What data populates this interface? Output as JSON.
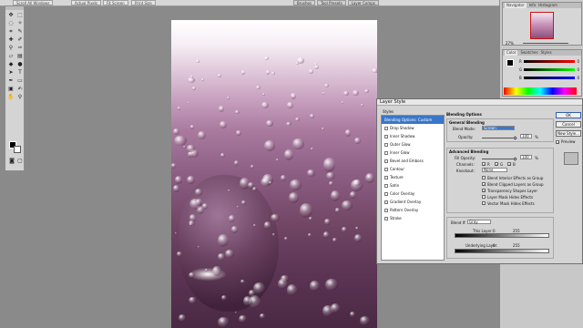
{
  "options_bar": {
    "checkbox_label": "Scroll All Windows",
    "buttons": [
      "Actual Pixels",
      "Fit Screen",
      "Print Size"
    ]
  },
  "panel_tabs": [
    "Brushes",
    "Tool Presets",
    "Layer Comps"
  ],
  "navigator": {
    "tabs": [
      "Navigator",
      "Info",
      "Histogram"
    ],
    "zoom": "27%"
  },
  "color_panel": {
    "tabs": [
      "Color",
      "Swatches",
      "Styles"
    ],
    "channels": [
      {
        "label": "R",
        "value": "0"
      },
      {
        "label": "G",
        "value": "0"
      },
      {
        "label": "B",
        "value": "0"
      }
    ]
  },
  "dialog": {
    "title": "Layer Style",
    "styles_header": "Styles",
    "styles": [
      {
        "label": "Blending Options: Custom",
        "selected": true,
        "checkbox": false
      },
      {
        "label": "Drop Shadow",
        "checkbox": true
      },
      {
        "label": "Inner Shadow",
        "checkbox": true
      },
      {
        "label": "Outer Glow",
        "checkbox": true
      },
      {
        "label": "Inner Glow",
        "checkbox": true
      },
      {
        "label": "Bevel and Emboss",
        "checkbox": true
      },
      {
        "label": "Contour",
        "checkbox": true
      },
      {
        "label": "Texture",
        "checkbox": true
      },
      {
        "label": "Satin",
        "checkbox": true
      },
      {
        "label": "Color Overlay",
        "checkbox": true
      },
      {
        "label": "Gradient Overlay",
        "checkbox": true
      },
      {
        "label": "Pattern Overlay",
        "checkbox": true
      },
      {
        "label": "Stroke",
        "checkbox": true
      }
    ],
    "blending_options": "Blending Options",
    "general_blending": "General Blending",
    "blend_mode_label": "Blend Mode:",
    "blend_mode_value": "Screen",
    "opacity_label": "Opacity:",
    "opacity_value": "100",
    "percent": "%",
    "advanced_blending": "Advanced Blending",
    "fill_opacity_label": "Fill Opacity:",
    "fill_opacity_value": "100",
    "channels_label": "Channels:",
    "channels": [
      "R",
      "G",
      "B"
    ],
    "knockout_label": "Knockout:",
    "knockout_value": "None",
    "checks": [
      {
        "label": "Blend Interior Effects as Group",
        "checked": false
      },
      {
        "label": "Blend Clipped Layers as Group",
        "checked": true
      },
      {
        "label": "Transparency Shapes Layer",
        "checked": true
      },
      {
        "label": "Layer Mask Hides Effects",
        "checked": false
      },
      {
        "label": "Vector Mask Hides Effects",
        "checked": false
      }
    ],
    "blend_if_label": "Blend If:",
    "blend_if_value": "Gray",
    "this_layer_label": "This Layer:",
    "this_layer_low": "0",
    "this_layer_high": "255",
    "underlying_label": "Underlying Layer:",
    "underlying_low": "0",
    "underlying_high": "255",
    "buttons": {
      "ok": "OK",
      "cancel": "Cancel",
      "new_style": "New Style...",
      "preview": "Preview"
    },
    "preview_checked": true
  },
  "colors": {
    "selection": "#3a76c8",
    "navigator_frame": "#d01010"
  }
}
